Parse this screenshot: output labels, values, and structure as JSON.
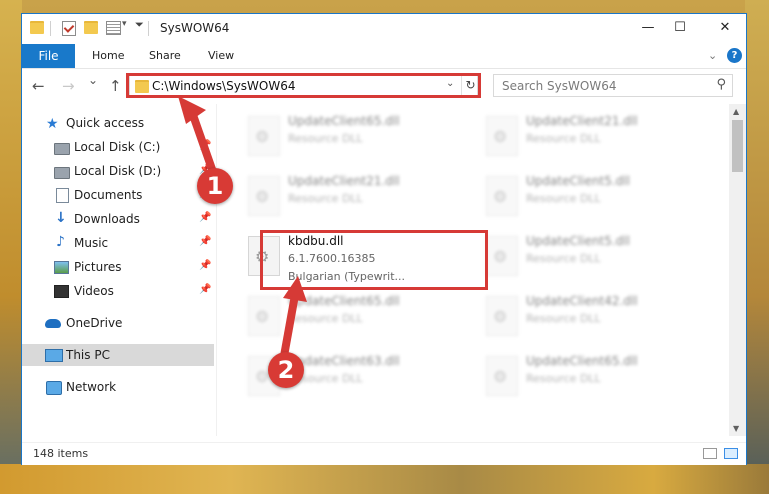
{
  "window": {
    "title": "SysWOW64",
    "controls": {
      "minimize": "—",
      "maximize": "☐",
      "close": "✕"
    }
  },
  "ribbon": {
    "tabs": [
      "File",
      "Home",
      "Share",
      "View"
    ],
    "help": "?"
  },
  "address": {
    "path": "C:\\Windows\\SysWOW64",
    "refresh": "↻",
    "dropdown": "⌄"
  },
  "search": {
    "placeholder": "Search SysWOW64",
    "icon": "search-icon"
  },
  "nav_buttons": {
    "back": "←",
    "forward": "→",
    "recent": "⌄",
    "up": "↑"
  },
  "sidebar": {
    "items": [
      {
        "label": "Quick access",
        "icon": "star-icon",
        "pinned": false,
        "selected": false
      },
      {
        "label": "Local Disk (C:)",
        "icon": "drive-icon",
        "pinned": true,
        "selected": false
      },
      {
        "label": "Local Disk (D:)",
        "icon": "drive-icon",
        "pinned": true,
        "selected": false
      },
      {
        "label": "Documents",
        "icon": "documents-icon",
        "pinned": true,
        "selected": false
      },
      {
        "label": "Downloads",
        "icon": "downloads-icon",
        "pinned": true,
        "selected": false
      },
      {
        "label": "Music",
        "icon": "music-icon",
        "pinned": true,
        "selected": false
      },
      {
        "label": "Pictures",
        "icon": "pictures-icon",
        "pinned": true,
        "selected": false
      },
      {
        "label": "Videos",
        "icon": "videos-icon",
        "pinned": true,
        "selected": false
      },
      {
        "label": "OneDrive",
        "icon": "onedrive-icon",
        "pinned": false,
        "selected": false
      },
      {
        "label": "This PC",
        "icon": "this-pc-icon",
        "pinned": false,
        "selected": true
      },
      {
        "label": "Network",
        "icon": "network-icon",
        "pinned": false,
        "selected": false
      }
    ],
    "pin_glyph": "📌"
  },
  "files": {
    "left": [
      {
        "name": "UpdateClient65.dll",
        "type": "Resource DLL"
      },
      {
        "name": "UpdateClient21.dll",
        "type": "Resource DLL"
      },
      {
        "name": "kbdbu.dll",
        "type": "6.1.7600.16385",
        "desc": "Bulgarian (Typewrit..."
      },
      {
        "name": "UpdateClient65.dll",
        "type": "Resource DLL"
      },
      {
        "name": "UpdateClient63.dll",
        "type": "Resource DLL"
      }
    ],
    "right": [
      {
        "name": "UpdateClient21.dll",
        "type": "Resource DLL"
      },
      {
        "name": "UpdateClient5.dll",
        "type": "Resource DLL"
      },
      {
        "name": "UpdateClient5.dll",
        "type": "Resource DLL"
      },
      {
        "name": "UpdateClient42.dll",
        "type": "Resource DLL"
      },
      {
        "name": "UpdateClient65.dll",
        "type": "Resource DLL"
      }
    ]
  },
  "status": {
    "count": "148 items"
  },
  "annotations": {
    "step1": "1",
    "step2": "2",
    "color": "#d63a36"
  }
}
